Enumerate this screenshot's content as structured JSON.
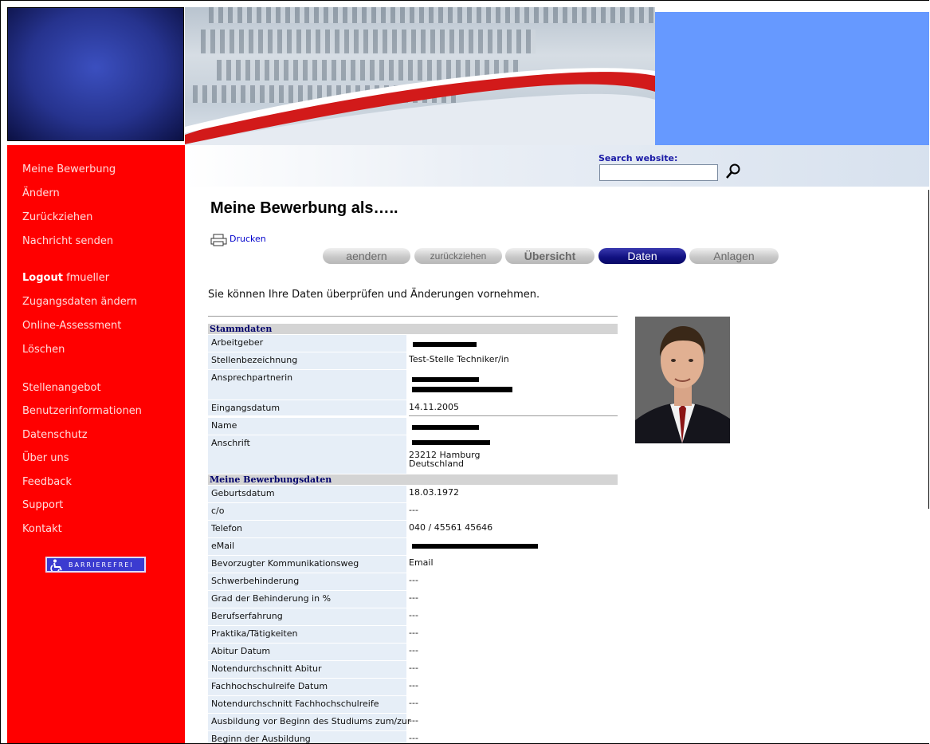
{
  "search": {
    "label": "Search website:",
    "placeholder": ""
  },
  "nav": {
    "items": [
      "Meine Bewerbung",
      "Ändern",
      "Zurückziehen",
      "Nachricht senden"
    ],
    "logout_label": "Logout",
    "logout_user": "fmueller",
    "account_items": [
      "Zugangsdaten ändern",
      "Online-Assessment",
      "Löschen"
    ],
    "info_items": [
      "Stellenangebot",
      "Benutzerinformationen",
      "Datenschutz",
      "Über uns",
      "Feedback",
      "Support",
      "Kontakt"
    ],
    "barrier_label": "BARRIEREFREI"
  },
  "main": {
    "title": "Meine Bewerbung als…..",
    "print_label": "Drucken",
    "tabs": [
      "aendern",
      "zurückziehen",
      "Übersicht",
      "Daten",
      "Anlagen"
    ],
    "active_tab": "Daten",
    "intro": "Sie können Ihre Daten überprüfen und Änderungen vornehmen."
  },
  "stammdaten": {
    "heading": "Stammdaten",
    "rows": [
      {
        "label": "Arbeitgeber",
        "value": ""
      },
      {
        "label": "Stellenbezeichnung",
        "value": "Test-Stelle Techniker/in"
      },
      {
        "label": "Ansprechpartnerin",
        "value": ""
      },
      {
        "label": "Eingangsdatum",
        "value": "14.11.2005"
      },
      {
        "label": "Name",
        "value": ""
      },
      {
        "label": "Anschrift",
        "value": "23212 Hamburg\nDeutschland"
      }
    ]
  },
  "bewerbungsdaten": {
    "heading": "Meine Bewerbungsdaten",
    "rows": [
      {
        "label": "Geburtsdatum",
        "value": "18.03.1972"
      },
      {
        "label": "c/o",
        "value": "---"
      },
      {
        "label": "Telefon",
        "value": "040 / 45561 45646"
      },
      {
        "label": "eMail",
        "value": ""
      },
      {
        "label": "Bevorzugter Kommunikationsweg",
        "value": "Email"
      },
      {
        "label": "Schwerbehinderung",
        "value": "---"
      },
      {
        "label": "Grad der Behinderung in %",
        "value": "---"
      },
      {
        "label": "Berufserfahrung",
        "value": "---"
      },
      {
        "label": "Praktika/Tätigkeiten",
        "value": "---"
      },
      {
        "label": "Abitur Datum",
        "value": "---"
      },
      {
        "label": "Notendurchschnitt Abitur",
        "value": "---"
      },
      {
        "label": "Fachhochschulreife Datum",
        "value": "---"
      },
      {
        "label": "Notendurchschnitt Fachhochschulreife",
        "value": "---"
      },
      {
        "label": "Ausbildung vor Beginn des Studiums zum/zur",
        "value": "---"
      },
      {
        "label": "Beginn der Ausbildung",
        "value": "---"
      }
    ]
  },
  "colors": {
    "sidebar": "#ff0000",
    "accent_blue": "#6699ff",
    "active_tab": "#101080"
  },
  "icons": [
    "search-icon",
    "printer-icon",
    "wheelchair-icon"
  ]
}
